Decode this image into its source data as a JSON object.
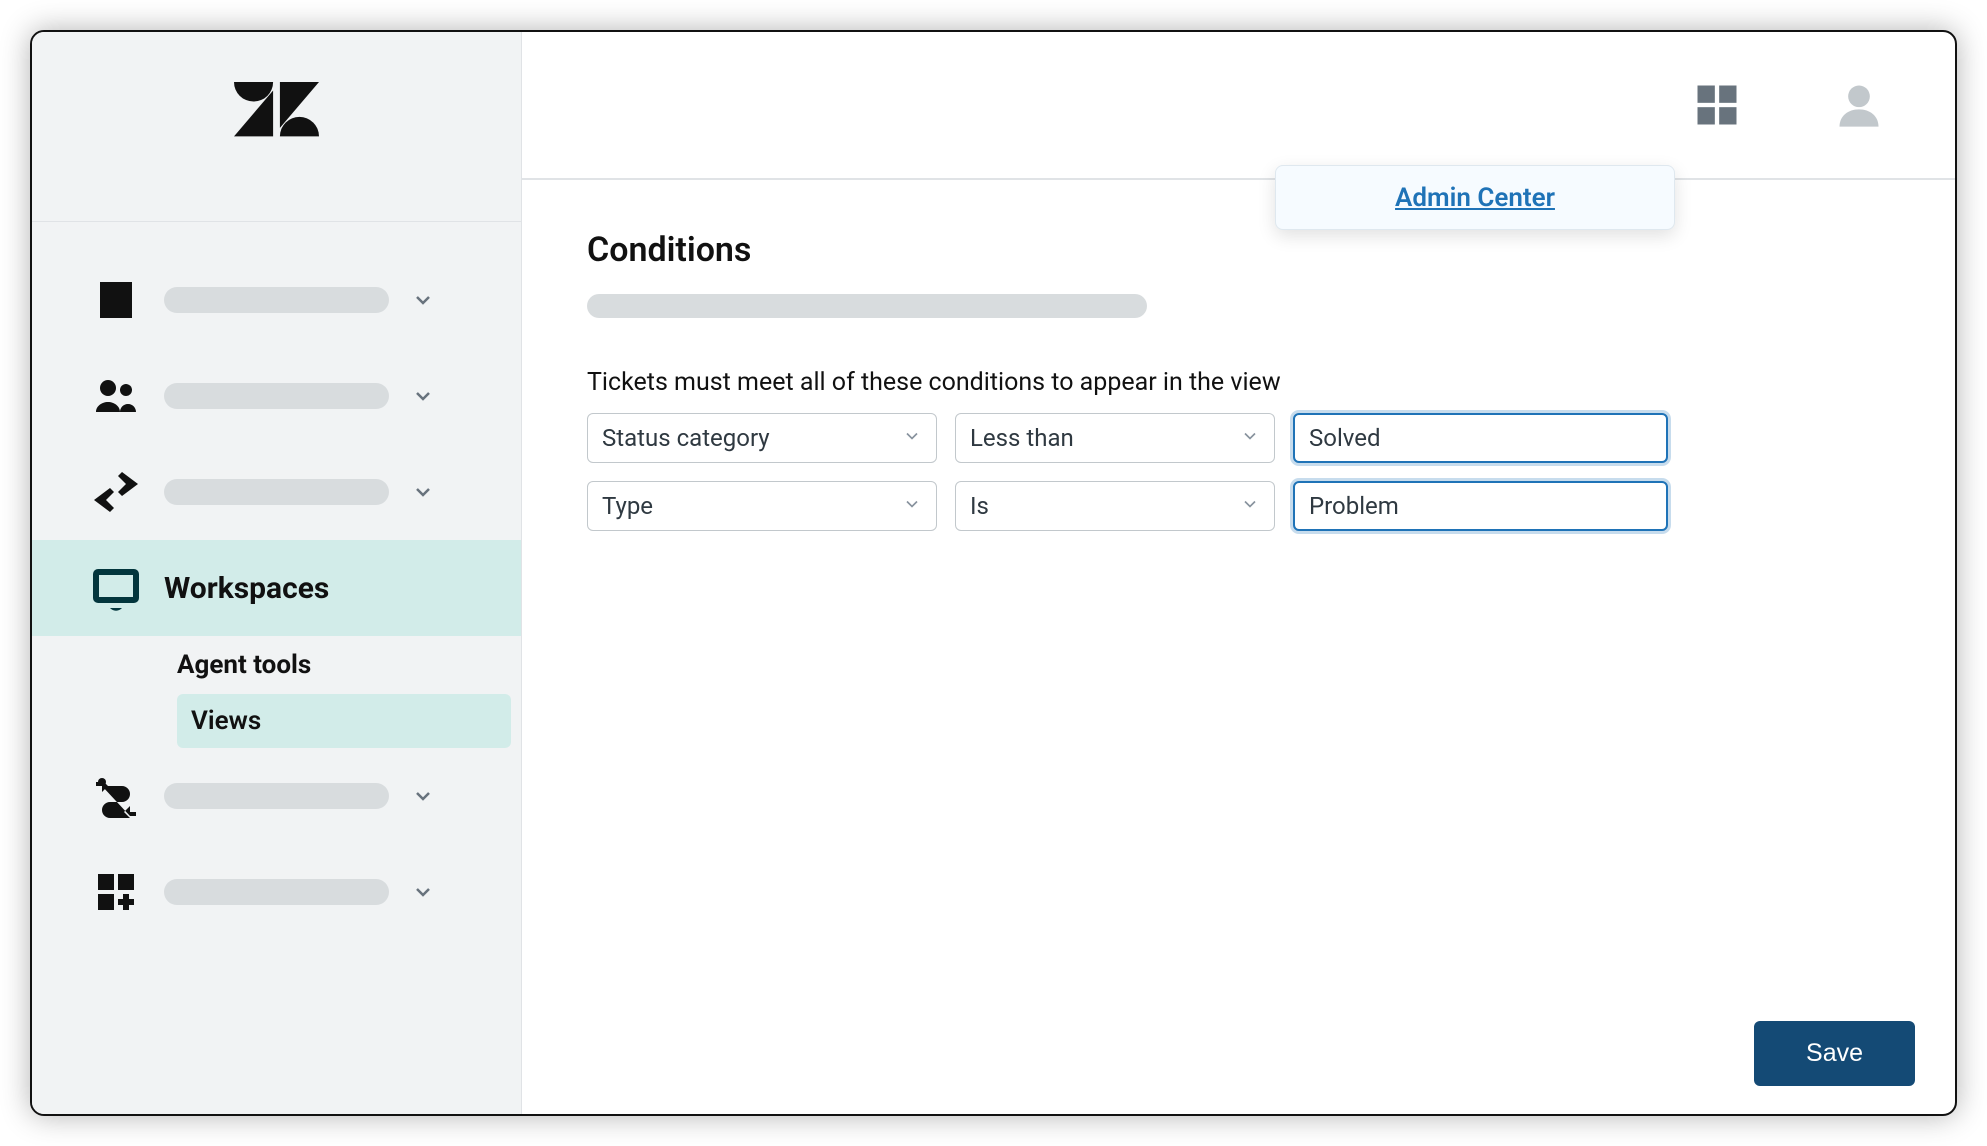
{
  "sidebar": {
    "workspaces_label": "Workspaces",
    "subnav": {
      "heading": "Agent tools",
      "views": "Views"
    }
  },
  "popover": {
    "link_label": "Admin Center"
  },
  "page": {
    "title": "Conditions",
    "instruction": "Tickets must meet all of these conditions to appear in the view"
  },
  "conditions": {
    "row1": {
      "field": "Status category",
      "operator": "Less than",
      "value": "Solved"
    },
    "row2": {
      "field": "Type",
      "operator": "Is",
      "value": "Problem"
    }
  },
  "actions": {
    "save": "Save"
  }
}
